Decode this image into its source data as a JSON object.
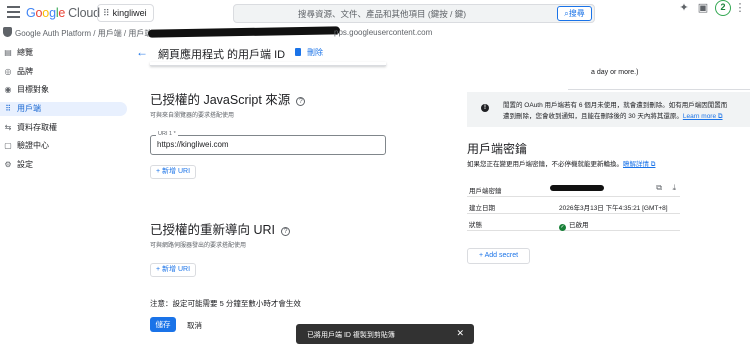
{
  "header": {
    "logo_google": [
      "G",
      "o",
      "o",
      "g",
      "l",
      "e"
    ],
    "logo_cloud": "Cloud",
    "project": "kingliwei",
    "search_placeholder": "搜尋資源、文件、產品和其他項目 (鍵按 / 鍵)",
    "search_button": "搜尋",
    "notification_count": "2"
  },
  "breadcrumb": {
    "prefix": "Google Auth Platform / 用戶端 / 用戶端",
    "suffix": "pps.googleusercontent.com"
  },
  "sidebar": {
    "items": [
      {
        "icon": "▤",
        "label": "總覽"
      },
      {
        "icon": "◎",
        "label": "品牌"
      },
      {
        "icon": "◉",
        "label": "目標對象"
      },
      {
        "icon": "⠿",
        "label": "用戶端"
      },
      {
        "icon": "⇆",
        "label": "資料存取權"
      },
      {
        "icon": "▢",
        "label": "驗證中心"
      },
      {
        "icon": "⚙",
        "label": "設定"
      }
    ]
  },
  "page": {
    "title": "網頁應用程式 的用戶端 ID",
    "delete_label": "刪除"
  },
  "js_origins": {
    "heading": "已授權的 JavaScript 來源",
    "subtitle": "可與來自瀏覽器的要求搭配使用",
    "uri_label": "URI 1 *",
    "uri_value": "https://kingliwei.com",
    "add_label": "+ 新增 URI"
  },
  "redirects": {
    "heading": "已授權的重新導向 URI",
    "subtitle": "可與網路伺服器發出的要求搭配使用",
    "add_label": "+ 新增 URI"
  },
  "footer": {
    "note": "注意：設定可能需要 5 分鐘至數小時才會生效",
    "save": "儲存",
    "cancel": "取消"
  },
  "toast": {
    "text": "已將用戶端 ID 複製到剪貼簿",
    "close": "✕"
  },
  "right": {
    "top_text": "a day or more.)",
    "info_line1": "閒置的 OAuth 用戶端若有 6 個月未使用，就會遭到刪除。如有用戶端因閒置而",
    "info_line2_text": "遭到刪除，您會收到通知，且能在刪除後的 30 天內將其還原。",
    "info_link": "Learn more ⧉",
    "secrets_heading": "用戶端密鑰",
    "secrets_desc": "如果您正在變更用戶端密鑰，不必停機就能更新輪換。",
    "secrets_link": "瞭解詳情 ⧉",
    "rows": [
      {
        "key": "用戶端密鑰",
        "value": ""
      },
      {
        "key": "建立日期",
        "value": "2026年3月13日 下午4:35:21 [GMT+8]"
      },
      {
        "key": "狀態",
        "value": "已啟用"
      }
    ],
    "add_secret": "+ Add secret"
  }
}
